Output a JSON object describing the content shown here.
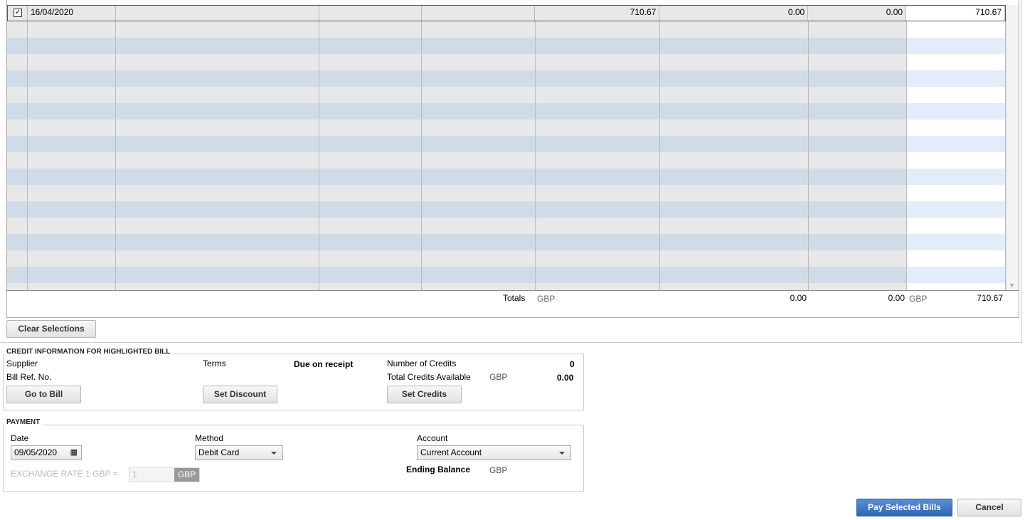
{
  "bills": {
    "rows": [
      {
        "checked": true,
        "date": "16/04/2020",
        "amt_due": "710.67",
        "disc": "0.00",
        "credits": "0.00",
        "amt_to_pay": "710.67"
      }
    ],
    "totals": {
      "label": "Totals",
      "currency": "GBP",
      "disc": "0.00",
      "credits": "0.00",
      "pay_currency": "GBP",
      "amt_to_pay": "710.67"
    }
  },
  "clear_selections": "Clear Selections",
  "credit": {
    "title": "CREDIT INFORMATION FOR HIGHLIGHTED BILL",
    "supplier": "Supplier",
    "bill_ref": "Bill Ref. No.",
    "terms_label": "Terms",
    "terms_value": "Due on receipt",
    "num_credits_label": "Number of Credits",
    "num_credits": "0",
    "total_credits_label": "Total Credits Available",
    "total_credits_currency": "GBP",
    "total_credits": "0.00",
    "go_to_bill": "Go to Bill",
    "set_discount": "Set Discount",
    "set_credits": "Set Credits"
  },
  "payment": {
    "title": "PAYMENT",
    "date_label": "Date",
    "date": "09/05/2020",
    "method_label": "Method",
    "method": "Debit Card",
    "account_label": "Account",
    "account": "Current Account",
    "exchange_label": "EXCHANGE RATE 1 GBP =",
    "exchange_value": "1",
    "exchange_currency": "GBP",
    "ending_balance_label": "Ending Balance",
    "ending_balance_currency": "GBP"
  },
  "pay_button": "Pay Selected Bills",
  "cancel_button": "Cancel"
}
